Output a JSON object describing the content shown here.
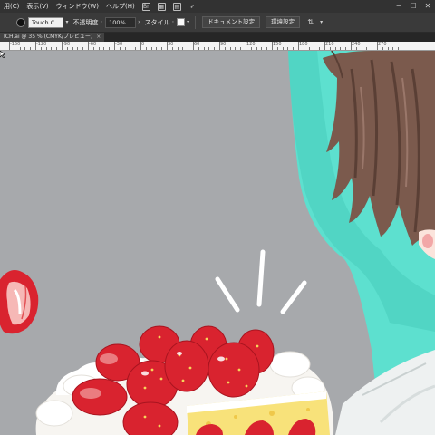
{
  "menubar": {
    "items": [
      "用(C)",
      "表示(V)",
      "ウィンドウ(W)",
      "ヘルプ(H)"
    ],
    "icons": [
      "br-icon",
      "workspace-icon",
      "arrange-icon",
      "launch-icon"
    ],
    "window_controls": [
      "─",
      "☐",
      "✕"
    ]
  },
  "controlbar": {
    "brush_name": "Touch C...",
    "opacity_label": "不透明度 :",
    "opacity_value": "100%",
    "style_label": "スタイル :",
    "document_setup_button": "ドキュメント設定",
    "preferences_button": "環境設定"
  },
  "tabs": [
    {
      "label": "ICH.ai @ 35 % (CMYK/プレビュー)",
      "close": "×"
    }
  ],
  "ruler": {
    "labels": [
      "-150",
      "-120",
      "-90",
      "-60",
      "-30",
      "0",
      "30",
      "60",
      "90",
      "120",
      "150",
      "180",
      "210",
      "240",
      "270"
    ]
  },
  "colors": {
    "canvas_bg": "#a7a9ac",
    "strawberry_red": "#d9232f",
    "teal_bg": "#5de0cf",
    "hair_brown": "#7b5a4d",
    "cream": "#f7f5f1"
  }
}
